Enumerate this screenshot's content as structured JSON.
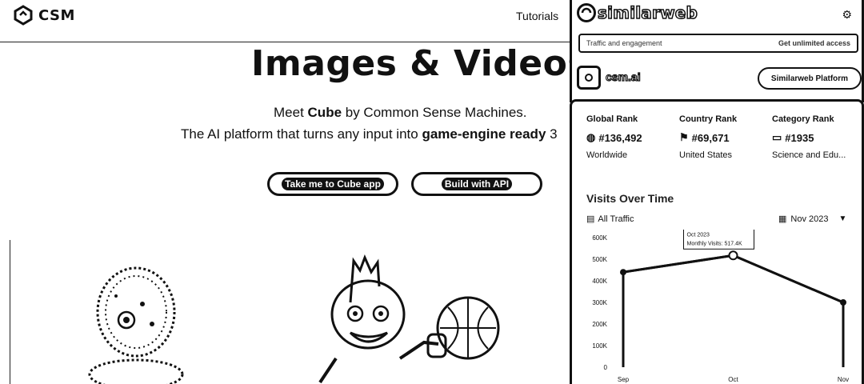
{
  "site": {
    "logo_text": "CSM",
    "nav": {
      "tutorials": "Tutorials"
    },
    "hero": {
      "title": "Images & Videos",
      "sub1_prefix": "Meet ",
      "sub1_bold": "Cube",
      "sub1_suffix": " by Common Sense Machines.",
      "sub2_prefix": "The AI platform that turns any input into ",
      "sub2_bold": "game-engine ready",
      "sub2_suffix": " 3"
    },
    "buttons": {
      "cube_app": "Take me to Cube app",
      "api": "Build with API"
    }
  },
  "similarweb": {
    "brand": "similarweb",
    "settings_icon": "gear-icon",
    "promo_left": "Traffic and engagement",
    "promo_right": "Get unlimited access",
    "domain": "csm.ai",
    "cta": "Similarweb Platform",
    "ranks": [
      {
        "label": "Global Rank",
        "icon": "globe-icon",
        "glyph": "◍",
        "value": "#136,492",
        "sub": "Worldwide"
      },
      {
        "label": "Country Rank",
        "icon": "flag-icon",
        "glyph": "⚑",
        "value": "#69,671",
        "sub": "United States"
      },
      {
        "label": "Category Rank",
        "icon": "category-icon",
        "glyph": "▭",
        "value": "#1935",
        "sub": "Science and Edu..."
      }
    ],
    "visits": {
      "title": "Visits Over Time",
      "filter": "All Traffic",
      "month": "Nov 2023",
      "tooltip_month": "Oct 2023",
      "tooltip_value": "Monthly Visits: 517.4K"
    }
  },
  "chart_data": {
    "type": "line",
    "categories": [
      "Sep",
      "Oct",
      "Nov"
    ],
    "values": [
      440000,
      517400,
      300000
    ],
    "ylim": [
      0,
      600000
    ],
    "yticks": [
      "0",
      "100K",
      "200K",
      "300K",
      "400K",
      "500K",
      "600K"
    ],
    "xlabel": "",
    "ylabel": "",
    "grid": false,
    "color": "#111111"
  }
}
